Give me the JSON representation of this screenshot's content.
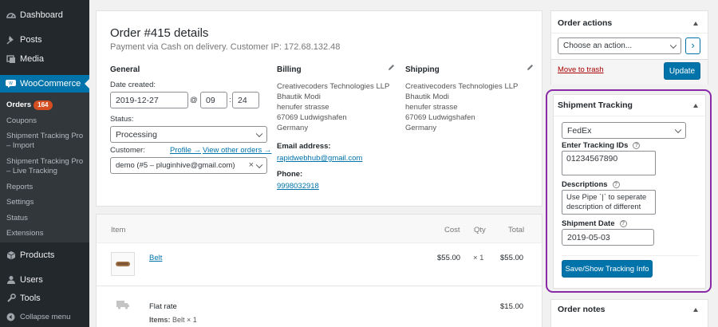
{
  "sidebar": {
    "dashboard": "Dashboard",
    "posts": "Posts",
    "media": "Media",
    "woocommerce": "WooCommerce",
    "submenu": {
      "orders": "Orders",
      "orders_count": "164",
      "coupons": "Coupons",
      "tracking_import": "Shipment Tracking Pro – Import",
      "tracking_live": "Shipment Tracking Pro – Live Tracking",
      "reports": "Reports",
      "settings": "Settings",
      "status": "Status",
      "extensions": "Extensions"
    },
    "products": "Products",
    "users": "Users",
    "tools": "Tools",
    "collapse": "Collapse menu"
  },
  "order": {
    "title": "Order #415 details",
    "subtitle": "Payment via Cash on delivery. Customer IP: 172.68.132.48",
    "general": {
      "heading": "General",
      "date_label": "Date created:",
      "date": "2019-12-27",
      "at": "@",
      "hour": "09",
      "colon": ":",
      "minute": "24",
      "status_label": "Status:",
      "status": "Processing",
      "customer_label": "Customer:",
      "profile_link": "Profile →",
      "other_orders_link": "View other orders →",
      "customer": "demo (#5 – pluginhive@gmail.com)",
      "clear": "×"
    },
    "billing": {
      "heading": "Billing",
      "company": "Creativecoders Technologies LLP",
      "name": "Bhautik Modi",
      "street": "henufer strasse",
      "city": "67069 Ludwigshafen",
      "country": "Germany",
      "email_label": "Email address:",
      "email": "rapidwebhub@gmail.com",
      "phone_label": "Phone:",
      "phone": "9998032918"
    },
    "shipping": {
      "heading": "Shipping",
      "company": "Creativecoders Technologies LLP",
      "name": "Bhautik Modi",
      "street": "henufer strasse",
      "city": "67069 Ludwigshafen",
      "country": "Germany"
    }
  },
  "items": {
    "headers": {
      "item": "Item",
      "cost": "Cost",
      "qty": "Qty",
      "total": "Total"
    },
    "rows": [
      {
        "name": "Belt",
        "cost": "$55.00",
        "qty": "× 1",
        "total": "$55.00"
      }
    ],
    "shipping_row": {
      "name": "Flat rate",
      "total": "$15.00",
      "items_label": "Items:",
      "items_value": "Belt × 1"
    }
  },
  "order_actions": {
    "title": "Order actions",
    "select": "Choose an action...",
    "go": "›",
    "trash": "Move to trash",
    "update": "Update"
  },
  "shipment_tracking": {
    "title": "Shipment Tracking",
    "carrier": "FedEx",
    "tracking_label": "Enter Tracking IDs",
    "tracking_value": "01234567890",
    "desc_label": "Descriptions",
    "desc_value": "Use Pipe `|` to seperate description of different",
    "date_label": "Shipment Date",
    "date_value": "2019-05-03",
    "button": "Save/Show Tracking Info",
    "help": "?",
    "highlight_color": "#8a2aa6"
  },
  "order_notes": {
    "title": "Order notes"
  },
  "colors": {
    "sidebar_bg": "#23282d",
    "accent": "#0073aa",
    "badge": "#d54e21",
    "trash": "#a00"
  }
}
